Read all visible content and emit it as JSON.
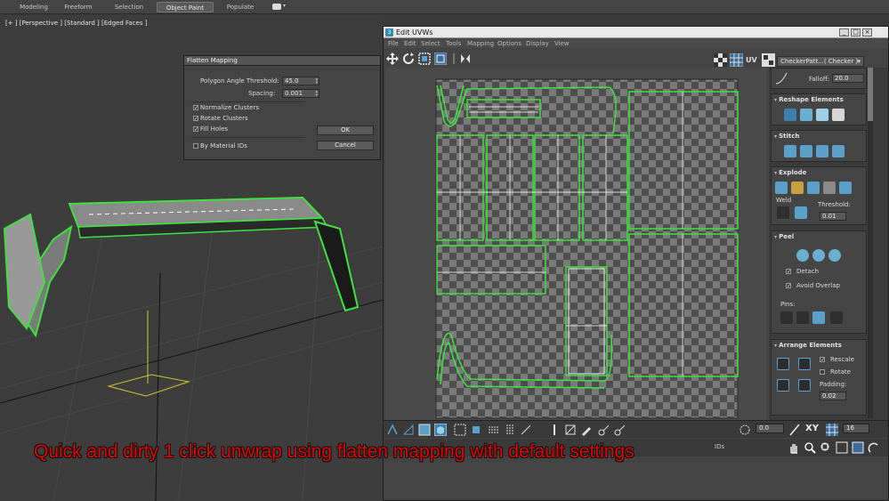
{
  "ribbon": {
    "tabs": [
      {
        "label": "Modeling",
        "active": false
      },
      {
        "label": "Freeform",
        "active": false
      },
      {
        "label": "Selection",
        "active": false
      },
      {
        "label": "Object Paint",
        "active": true
      },
      {
        "label": "Populate",
        "active": false
      }
    ]
  },
  "viewport": {
    "label": "[+ ] [Perspective ] [Standard ] [Edged Faces ]"
  },
  "flatten_dialog": {
    "title": "Flatten Mapping",
    "angle_label": "Polygon Angle Threshold:",
    "angle_value": "45.0",
    "spacing_label": "Spacing:",
    "spacing_value": "0.001",
    "normalize_label": "Normalize Clusters",
    "normalize_checked": true,
    "rotate_label": "Rotate Clusters",
    "rotate_checked": true,
    "fill_label": "Fill Holes",
    "fill_checked": true,
    "material_label": "By Material IDs",
    "material_checked": false,
    "ok_label": "OK",
    "cancel_label": "Cancel"
  },
  "uvw_editor": {
    "title": "Edit UVWs",
    "window_buttons": {
      "min": "_",
      "max": "□",
      "close": "×"
    },
    "menu": [
      "File",
      "Edit",
      "Select",
      "Tools",
      "Mapping",
      "Options",
      "Display",
      "View"
    ],
    "uv_label": "UV",
    "checker_dropdown": "CheckerPatt...( Checker )",
    "right_panel": {
      "falloff_label": "Falloff:",
      "falloff_value": "20.0",
      "reshape_title": "Reshape Elements",
      "stitch_title": "Stitch",
      "explode_title": "Explode",
      "weld_label": "Weld",
      "threshold_label": "Threshold:",
      "threshold_value": "0.01",
      "peel_title": "Peel",
      "detach_label": "Detach",
      "detach_checked": true,
      "avoid_overlap_label": "Avoid Overlap",
      "avoid_overlap_checked": true,
      "pins_label": "Pins:",
      "arrange_title": "Arrange Elements",
      "rescale_label": "Rescale",
      "rescale_checked": true,
      "rotate_label": "Rotate",
      "rotate_checked": false,
      "padding_label": "Padding:",
      "padding_value": "0.02"
    },
    "bottom": {
      "coord_value": "0.0",
      "xy_label": "XY",
      "zoom_value": "16",
      "ids_fragment": "IDs"
    }
  },
  "caption": "Quick and dirty 1 click unwrap using flatten mapping with default settings",
  "colors": {
    "selection_green": "#40e040",
    "caption_red": "#e00000",
    "checker_dark": "#4d4d4d",
    "checker_light": "#7a7a7a"
  }
}
